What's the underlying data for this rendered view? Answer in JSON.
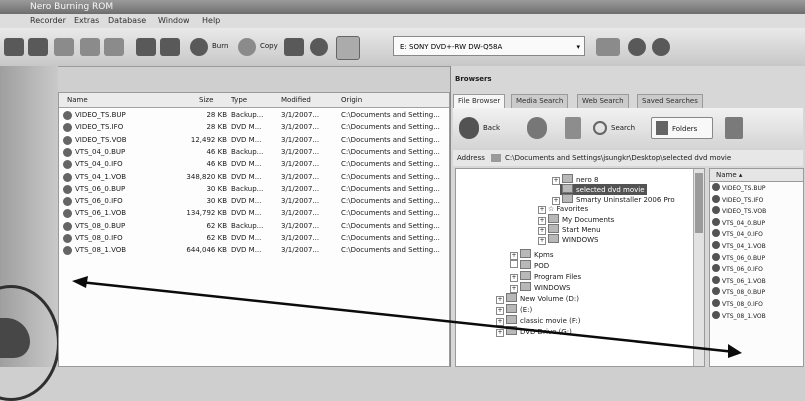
{
  "app": {
    "title": "Nero Burning ROM"
  },
  "menu": [
    "Recorder",
    "Extras",
    "Database",
    "Window",
    "Help"
  ],
  "toolbar": {
    "burn_label": "Burn",
    "copy_label": "Copy",
    "drive": "E: SONY DVD+-RW DW-Q58A"
  },
  "file_panel": {
    "columns": [
      "Name",
      "Size",
      "Type",
      "Modified",
      "Origin"
    ],
    "rows": [
      {
        "name": "VIDEO_TS.BUP",
        "size": "28 KB",
        "type": "Backup...",
        "modified": "3/1/2007...",
        "origin": "C:\\Documents and Setting..."
      },
      {
        "name": "VIDEO_TS.IFO",
        "size": "28 KB",
        "type": "DVD M...",
        "modified": "3/1/2007...",
        "origin": "C:\\Documents and Setting..."
      },
      {
        "name": "VIDEO_TS.VOB",
        "size": "12,492 KB",
        "type": "DVD M...",
        "modified": "3/1/2007...",
        "origin": "C:\\Documents and Setting..."
      },
      {
        "name": "VTS_04_0.BUP",
        "size": "46 KB",
        "type": "Backup...",
        "modified": "3/1/2007...",
        "origin": "C:\\Documents and Setting..."
      },
      {
        "name": "VTS_04_0.IFO",
        "size": "46 KB",
        "type": "DVD M...",
        "modified": "3/1/2007...",
        "origin": "C:\\Documents and Setting..."
      },
      {
        "name": "VTS_04_1.VOB",
        "size": "348,820 KB",
        "type": "DVD M...",
        "modified": "3/1/2007...",
        "origin": "C:\\Documents and Setting..."
      },
      {
        "name": "VTS_06_0.BUP",
        "size": "30 KB",
        "type": "Backup...",
        "modified": "3/1/2007...",
        "origin": "C:\\Documents and Setting..."
      },
      {
        "name": "VTS_06_0.IFO",
        "size": "30 KB",
        "type": "DVD M...",
        "modified": "3/1/2007...",
        "origin": "C:\\Documents and Setting..."
      },
      {
        "name": "VTS_06_1.VOB",
        "size": "134,792 KB",
        "type": "DVD M...",
        "modified": "3/1/2007...",
        "origin": "C:\\Documents and Setting..."
      },
      {
        "name": "VTS_08_0.BUP",
        "size": "62 KB",
        "type": "Backup...",
        "modified": "3/1/2007...",
        "origin": "C:\\Documents and Setting..."
      },
      {
        "name": "VTS_08_0.IFO",
        "size": "62 KB",
        "type": "DVD M...",
        "modified": "3/1/2007...",
        "origin": "C:\\Documents and Setting..."
      },
      {
        "name": "VTS_08_1.VOB",
        "size": "644,046 KB",
        "type": "DVD M...",
        "modified": "3/1/2007...",
        "origin": "C:\\Documents and Setting..."
      }
    ]
  },
  "browser": {
    "title": "Browsers",
    "tabs": [
      "File Browser",
      "Media Search",
      "Web Search",
      "Saved Searches"
    ],
    "back_label": "Back",
    "search_label": "Search",
    "folders_label": "Folders",
    "address_label": "Address",
    "address": "C:\\Documents and Settings\\jsungkr\\Desktop\\selected dvd movie",
    "tree": [
      "nero 8",
      "selected dvd movie",
      "Smarty Uninstaller 2006 Pro",
      "Favorites",
      "My Documents",
      "Start Menu",
      "WINDOWS",
      "Kpms",
      "POD",
      "Program Files",
      "WINDOWS",
      "New Volume (D:)",
      "(E:)",
      "classic movie (F:)",
      "DVD Drive (G:)"
    ],
    "list_header": "Name",
    "list_items": [
      "VIDEO_TS.BUP",
      "VIDEO_TS.IFO",
      "VIDEO_TS.VOB",
      "VTS_04_0.BUP",
      "VTS_04_0.IFO",
      "VTS_04_1.VOB",
      "VTS_06_0.BUP",
      "VTS_06_0.IFO",
      "VTS_06_1.VOB",
      "VTS_08_0.BUP",
      "VTS_08_0.IFO",
      "VTS_08_1.VOB"
    ]
  }
}
